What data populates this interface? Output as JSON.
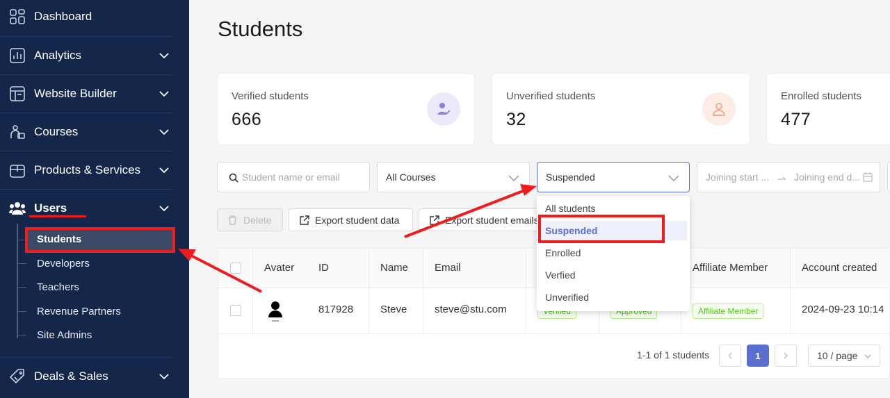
{
  "sidebar": {
    "items": [
      {
        "label": "Dashboard"
      },
      {
        "label": "Analytics"
      },
      {
        "label": "Website Builder"
      },
      {
        "label": "Courses"
      },
      {
        "label": "Products & Services"
      },
      {
        "label": "Users"
      },
      {
        "label": "Deals & Sales"
      }
    ],
    "users_sub": [
      {
        "label": "Students"
      },
      {
        "label": "Developers"
      },
      {
        "label": "Teachers"
      },
      {
        "label": "Revenue Partners"
      },
      {
        "label": "Site Admins"
      }
    ]
  },
  "page": {
    "title": "Students"
  },
  "stats": [
    {
      "label": "Verified students",
      "value": "666"
    },
    {
      "label": "Unverified students",
      "value": "32"
    },
    {
      "label": "Enrolled students",
      "value": "477"
    }
  ],
  "filters": {
    "search_placeholder": "Student name or email",
    "course_value": "All Courses",
    "status_value": "Suspended",
    "start_placeholder": "Joining start ...",
    "end_placeholder": "Joining end d..."
  },
  "actions": {
    "delete": "Delete",
    "export_data": "Export student data",
    "export_emails": "Export student emails"
  },
  "table": {
    "headers": [
      "Avater",
      "ID",
      "Name",
      "Email",
      "Affiliate Member",
      "Account created"
    ],
    "rows": [
      {
        "id": "817928",
        "name": "Steve",
        "email": "steve@stu.com",
        "status1": "Verified",
        "status2": "Approved",
        "affiliate": "Affiliate Member",
        "created": "2024-09-23 10:14"
      }
    ]
  },
  "pagination": {
    "summary": "1-1 of 1 students",
    "current": "1",
    "page_size": "10 / page"
  },
  "status_dropdown": {
    "options": [
      "All students",
      "Suspended",
      "Enrolled",
      "Verfied",
      "Unverified"
    ],
    "selected": "Suspended"
  },
  "colors": {
    "sidebar_bg": "#14264a",
    "accent": "#5b6fd1",
    "annotation": "#ee1c1c"
  }
}
